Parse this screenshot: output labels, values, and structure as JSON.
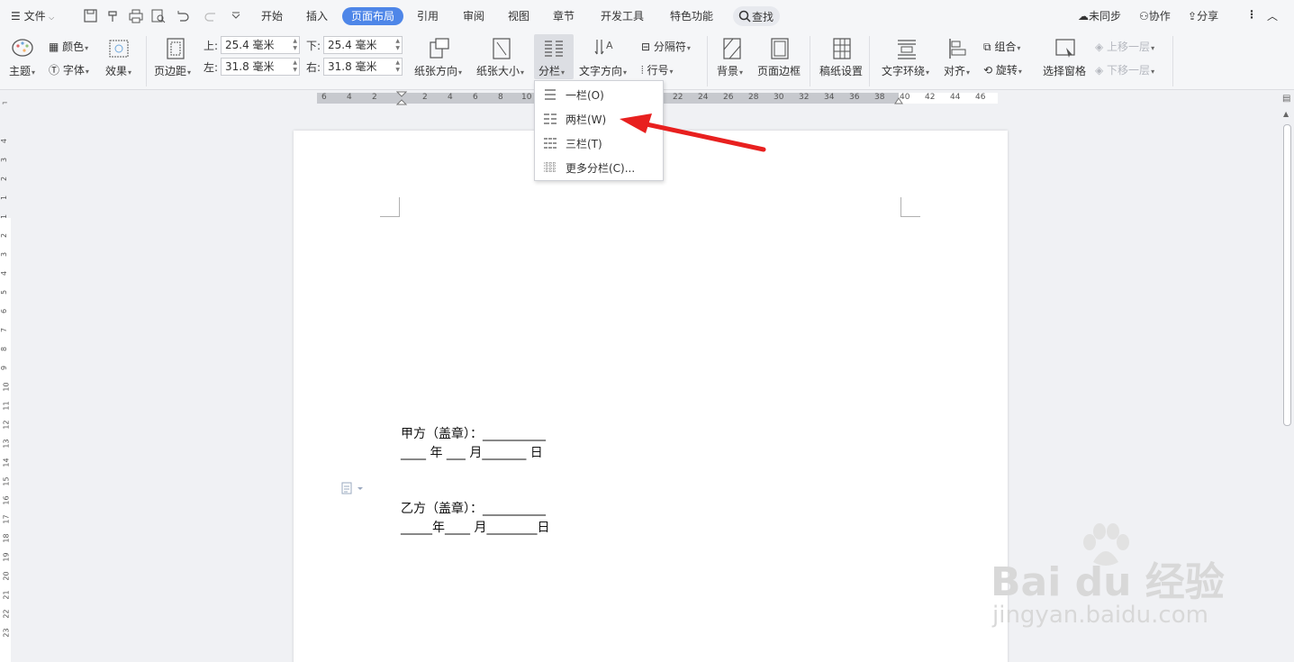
{
  "menubar": {
    "file_label": "文件",
    "tabs": [
      "开始",
      "插入",
      "页面布局",
      "引用",
      "审阅",
      "视图",
      "章节",
      "开发工具",
      "特色功能"
    ],
    "active_tab": "页面布局",
    "search_label": "查找",
    "sync_label": "未同步",
    "collab_label": "协作",
    "share_label": "分享"
  },
  "ribbon": {
    "theme": "主题",
    "color": "颜色",
    "font": "字体",
    "effect": "效果",
    "margins": "页边距",
    "top_label": "上:",
    "top_value": "25.4 毫米",
    "bottom_label": "下:",
    "bottom_value": "25.4 毫米",
    "left_label": "左:",
    "left_value": "31.8 毫米",
    "right_label": "右:",
    "right_value": "31.8 毫米",
    "orientation": "纸张方向",
    "size": "纸张大小",
    "columns": "分栏",
    "text_direction": "文字方向",
    "breaks": "分隔符",
    "line_numbers": "行号",
    "background": "背景",
    "page_border": "页面边框",
    "manuscript": "稿纸设置",
    "wrap": "文字环绕",
    "align": "对齐",
    "group": "组合",
    "rotate": "旋转",
    "selection_pane": "选择窗格",
    "bring_forward": "上移一层",
    "send_backward": "下移一层"
  },
  "ruler": {
    "h_numbers": [
      "6",
      "4",
      "2",
      "2",
      "4",
      "6",
      "8",
      "10",
      "22",
      "24",
      "26",
      "28",
      "30",
      "32",
      "34",
      "36",
      "38",
      "40",
      "42",
      "44",
      "46"
    ],
    "v_numbers": [
      "4",
      "3",
      "2",
      "1",
      "1",
      "2",
      "3",
      "4",
      "5",
      "6",
      "7",
      "8",
      "9",
      "10",
      "11",
      "12",
      "13",
      "14",
      "15",
      "16",
      "17",
      "18",
      "19",
      "20",
      "21",
      "22",
      "23"
    ]
  },
  "columns_menu": {
    "items": [
      "一栏(O)",
      "两栏(W)",
      "三栏(T)",
      "更多分栏(C)..."
    ]
  },
  "document": {
    "party_a": "甲方（盖章）：__________",
    "party_a_date": "____ 年 ___ 月_______ 日",
    "party_b": "乙方（盖章）：__________",
    "party_b_date": "_____年____ 月________日"
  },
  "watermark": {
    "brand": "Bai du 经验",
    "url": "jingyan.baidu.com"
  },
  "colors": {
    "accent": "#4e86e8",
    "arrow": "#e8201f",
    "ribbon_bg": "#f5f6f8",
    "canvas_bg": "#f0f1f4"
  }
}
